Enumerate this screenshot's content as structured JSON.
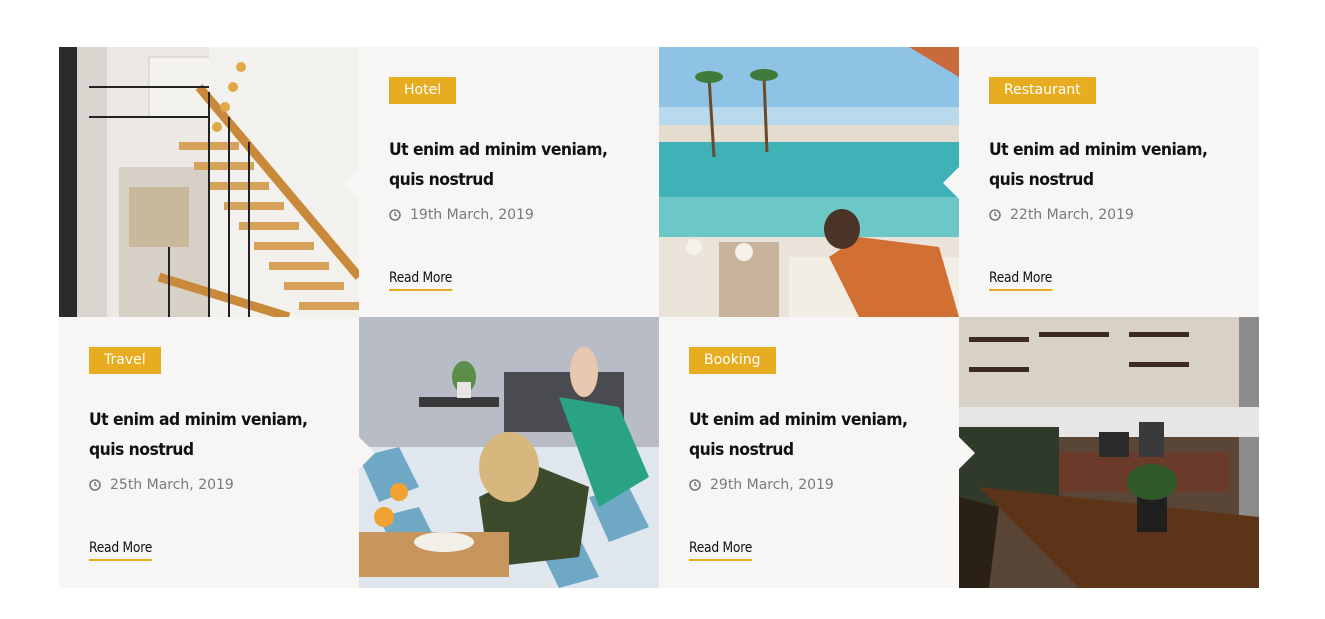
{
  "cards": [
    {
      "category": "Hotel",
      "title": "Ut enim ad minim veniam, quis nostrud",
      "date": "19th March, 2019",
      "read_more": "Read More"
    },
    {
      "category": "Restaurant",
      "title": "Ut enim ad minim veniam, quis nostrud",
      "date": "22th March, 2019",
      "read_more": "Read More"
    },
    {
      "category": "Travel",
      "title": "Ut enim ad minim veniam, quis nostrud",
      "date": "25th March, 2019",
      "read_more": "Read More"
    },
    {
      "category": "Booking",
      "title": "Ut enim ad minim veniam, quis nostrud",
      "date": "29th March, 2019",
      "read_more": "Read More"
    }
  ],
  "icons": {
    "date_icon": "clock-icon"
  },
  "colors": {
    "accent": "#e8ac21",
    "card_bg": "#f7f6f4",
    "title": "#111111",
    "meta": "#7a7a7a"
  }
}
